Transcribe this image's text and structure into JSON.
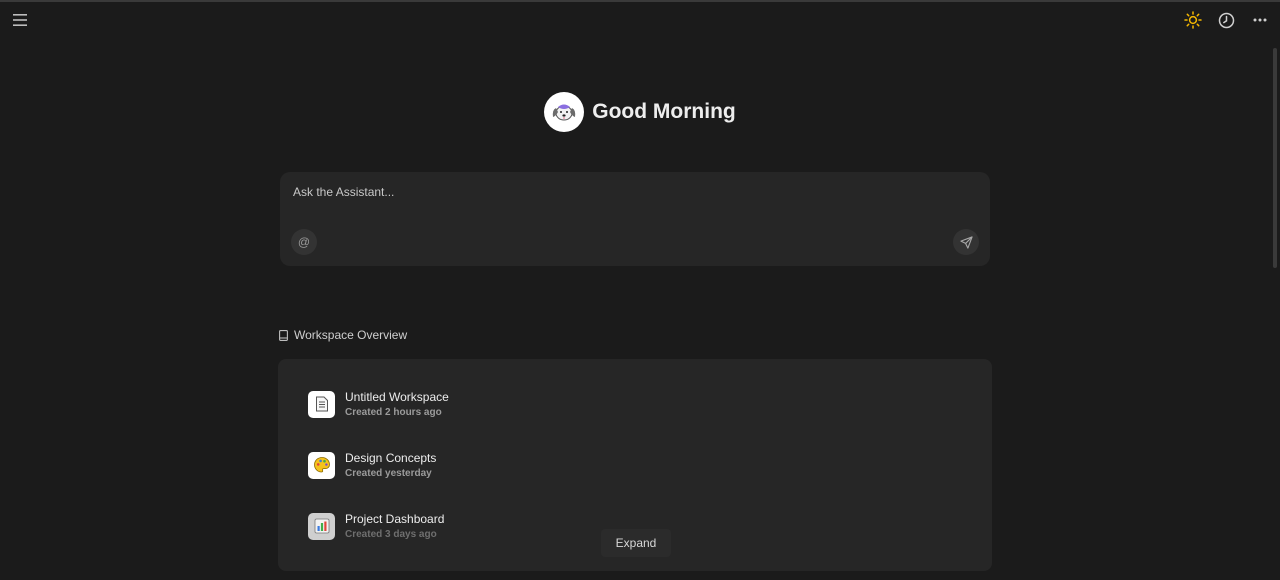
{
  "header": {
    "menu_icon": "hamburger-menu-icon",
    "theme_icon": "sun-icon",
    "history_icon": "clock-icon",
    "more_icon": "more-horizontal-icon",
    "accent_color": "#f5b800"
  },
  "greeting": {
    "avatar_icon": "dog-avatar-icon",
    "text": "Good Morning"
  },
  "composer": {
    "placeholder": "Ask the Assistant...",
    "value": "",
    "mention_symbol": "@",
    "send_icon": "send-icon"
  },
  "workspace": {
    "section_icon": "book-icon",
    "section_title": "Workspace Overview",
    "items": [
      {
        "title": "Untitled Workspace",
        "subtitle": "Created 2 hours ago",
        "icon": "document-icon"
      },
      {
        "title": "Design Concepts",
        "subtitle": "Created yesterday",
        "icon": "palette-icon"
      },
      {
        "title": "Project Dashboard",
        "subtitle": "Created 3 days ago",
        "icon": "bar-chart-icon"
      }
    ],
    "expand_label": "Expand"
  }
}
